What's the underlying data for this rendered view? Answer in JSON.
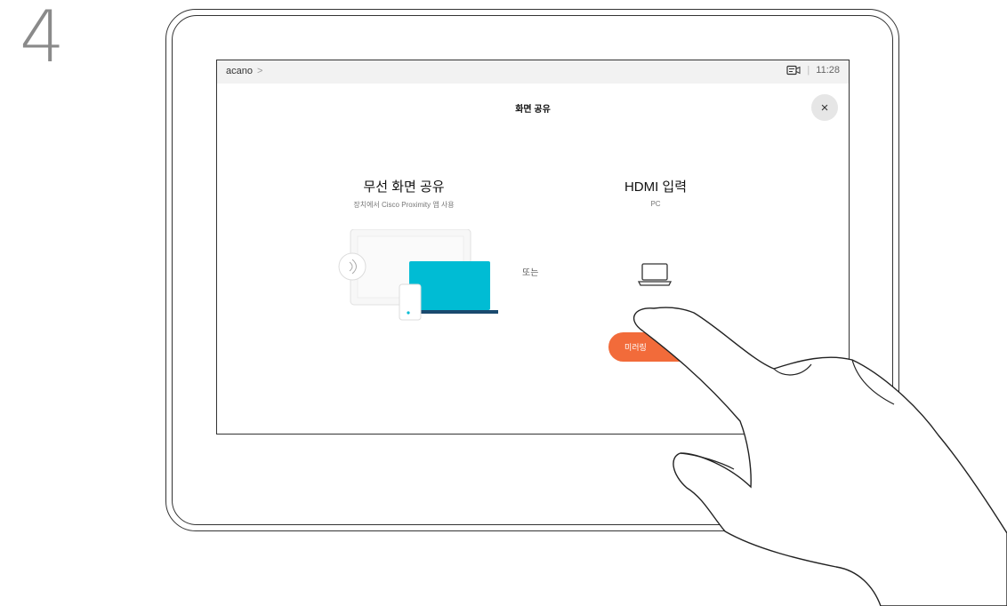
{
  "step_number": "4",
  "status_bar": {
    "brand": "acano",
    "brand_chevron": ">",
    "separator": "|",
    "time": "11:28",
    "camera_icon": "camera-screen-icon"
  },
  "modal": {
    "title": "화면 공유",
    "close_icon": "close-icon",
    "close_glyph": "×"
  },
  "wireless_option": {
    "title": "무선 화면 공유",
    "subtitle": "장치에서 Cisco Proximity 앱 사용",
    "illustration": "laptop-phone-wireless-illustration"
  },
  "or_label": "또는",
  "hdmi_option": {
    "title": "HDMI 입력",
    "subtitle": "PC",
    "icon": "laptop-icon",
    "button_label": "미러링"
  },
  "colors": {
    "accent_orange": "#f26b3a",
    "laptop_cyan": "#00bcd4",
    "laptop_base": "#1a4a6e"
  }
}
